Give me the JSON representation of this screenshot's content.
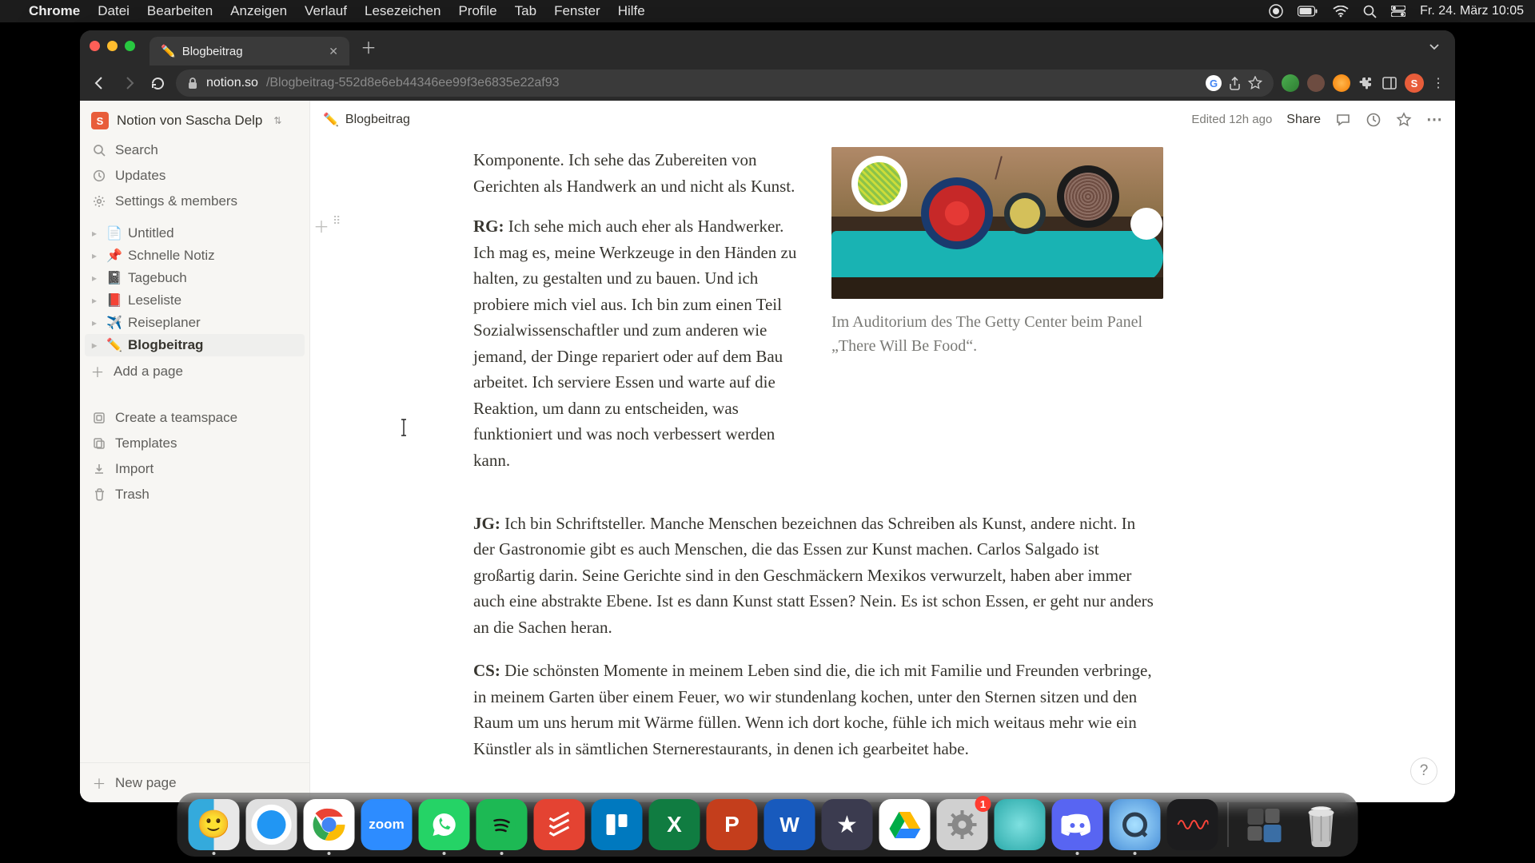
{
  "menubar": {
    "app": "Chrome",
    "items": [
      "Datei",
      "Bearbeiten",
      "Anzeigen",
      "Verlauf",
      "Lesezeichen",
      "Profile",
      "Tab",
      "Fenster",
      "Hilfe"
    ],
    "clock": "Fr. 24. März  10:05"
  },
  "browser": {
    "tab_title": "Blogbeitrag",
    "tab_emoji": "✏️",
    "url_domain": "notion.so",
    "url_path": "/Blogbeitrag-552d8e6eb44346ee99f3e6835e22af93"
  },
  "workspace": {
    "initial": "S",
    "name": "Notion von Sascha Delp"
  },
  "sidebar": {
    "search": "Search",
    "updates": "Updates",
    "settings": "Settings & members",
    "pages": [
      {
        "emoji": "📄",
        "label": "Untitled",
        "active": false
      },
      {
        "emoji": "📌",
        "label": "Schnelle Notiz",
        "active": false
      },
      {
        "emoji": "📓",
        "label": "Tagebuch",
        "active": false
      },
      {
        "emoji": "📕",
        "label": "Leseliste",
        "active": false
      },
      {
        "emoji": "✈️",
        "label": "Reiseplaner",
        "active": false
      },
      {
        "emoji": "✏️",
        "label": "Blogbeitrag",
        "active": true
      }
    ],
    "add_page": "Add a page",
    "teamspace": "Create a teamspace",
    "templates": "Templates",
    "import": "Import",
    "trash": "Trash",
    "new_page": "New page"
  },
  "topbar": {
    "emoji": "✏️",
    "title": "Blogbeitrag",
    "edited": "Edited 12h ago",
    "share": "Share"
  },
  "article": {
    "p1_lead": "Komponente. Ich sehe das Zubereiten von Gerichten als Handwerk an und nicht als Kunst.",
    "p2_speaker": "RG:",
    "p2_text": " Ich sehe mich auch eher als Handwerker. Ich mag es, meine Werkzeuge in den Händen zu halten, zu gestalten und zu bauen. Und ich probiere mich viel aus. Ich bin zum einen Teil Sozialwissenschaftler und zum anderen wie jemand, der Dinge repariert oder auf dem Bau arbeitet. Ich serviere Essen und warte auf die Reaktion, um dann zu entscheiden, was funktioniert und was noch verbessert werden kann.",
    "caption": "Im Auditorium des The Getty Center beim Panel „There Will Be Food“.",
    "p3_speaker": "JG:",
    "p3_text": " Ich bin Schriftsteller. Manche Menschen bezeichnen das Schreiben als Kunst, andere nicht. In der Gastronomie gibt es auch Menschen, die das Essen zur Kunst machen. Carlos Salgado ist großartig darin. Seine Gerichte sind in den Geschmäckern Mexikos verwurzelt, haben aber immer auch eine abstrakte Ebene. Ist es dann Kunst statt Essen? Nein. Es ist schon Essen, er geht nur anders an die Sachen heran.",
    "p4_speaker": "CS:",
    "p4_text": " Die schönsten Momente in meinem Leben sind die, die ich mit Familie und Freunden verbringe, in meinem Garten über einem Feuer, wo wir stundenlang kochen, unter den Sternen sitzen und den Raum um uns herum mit Wärme füllen. Wenn ich dort koche, fühle ich mich weitaus mehr wie ein Künstler als in sämtlichen Sternerestaurants, in denen ich gearbeitet habe."
  },
  "dock": {
    "settings_badge": "1"
  }
}
